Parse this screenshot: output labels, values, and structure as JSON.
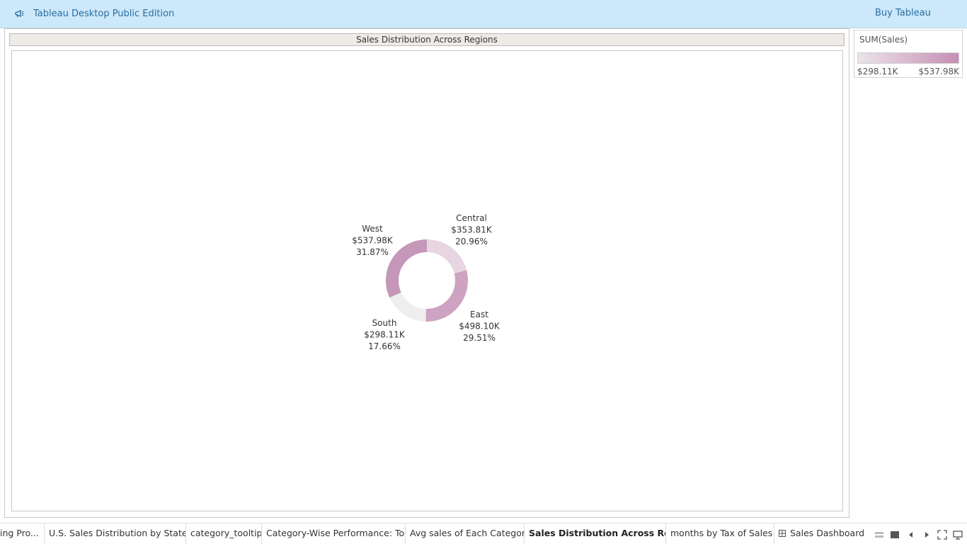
{
  "topbar": {
    "app_title": "Tableau Desktop Public Edition",
    "buy_label": "Buy Tableau",
    "icon": "megaphone-icon"
  },
  "worksheet": {
    "title": "Sales Distribution Across Regions"
  },
  "legend": {
    "title": "SUM(Sales)",
    "min_label": "$298.11K",
    "max_label": "$537.98K",
    "color_low": "#ece3ea",
    "color_high": "#c58fb4"
  },
  "chart_data": {
    "type": "pie",
    "variant": "donut",
    "title": "Sales Distribution Across Regions",
    "measure": "SUM(Sales)",
    "slices": [
      {
        "label": "Central",
        "value": 353.81,
        "value_label": "$353.81K",
        "percent_label": "20.96%",
        "color": "#e7d6e2"
      },
      {
        "label": "East",
        "value": 498.1,
        "value_label": "$498.10K",
        "percent_label": "29.51%",
        "color": "#cda3c1"
      },
      {
        "label": "South",
        "value": 298.11,
        "value_label": "$298.11K",
        "percent_label": "17.66%",
        "color": "#efeeee"
      },
      {
        "label": "West",
        "value": 537.98,
        "value_label": "$537.98K",
        "percent_label": "31.87%",
        "color": "#c597b8"
      }
    ]
  },
  "tabs": [
    {
      "label": "ing Pro...",
      "active": false
    },
    {
      "label": "U.S. Sales Distribution by State ...",
      "active": false
    },
    {
      "label": "category_tooltip",
      "active": false
    },
    {
      "label": "Category-Wise Performance: To...",
      "active": false
    },
    {
      "label": "Avg sales of Each Category",
      "active": false
    },
    {
      "label": "Sales Distribution Across Regi...",
      "active": true
    },
    {
      "label": "months by Tax of Sales",
      "active": false
    },
    {
      "label": "Sales Dashboard",
      "active": false,
      "icon": "dashboard-icon"
    }
  ],
  "controls": [
    "sheet-sorter-icon",
    "film-strip-icon",
    "previous-sheet-icon",
    "next-sheet-icon",
    "presentation-mode-icon",
    "device-preview-icon"
  ]
}
